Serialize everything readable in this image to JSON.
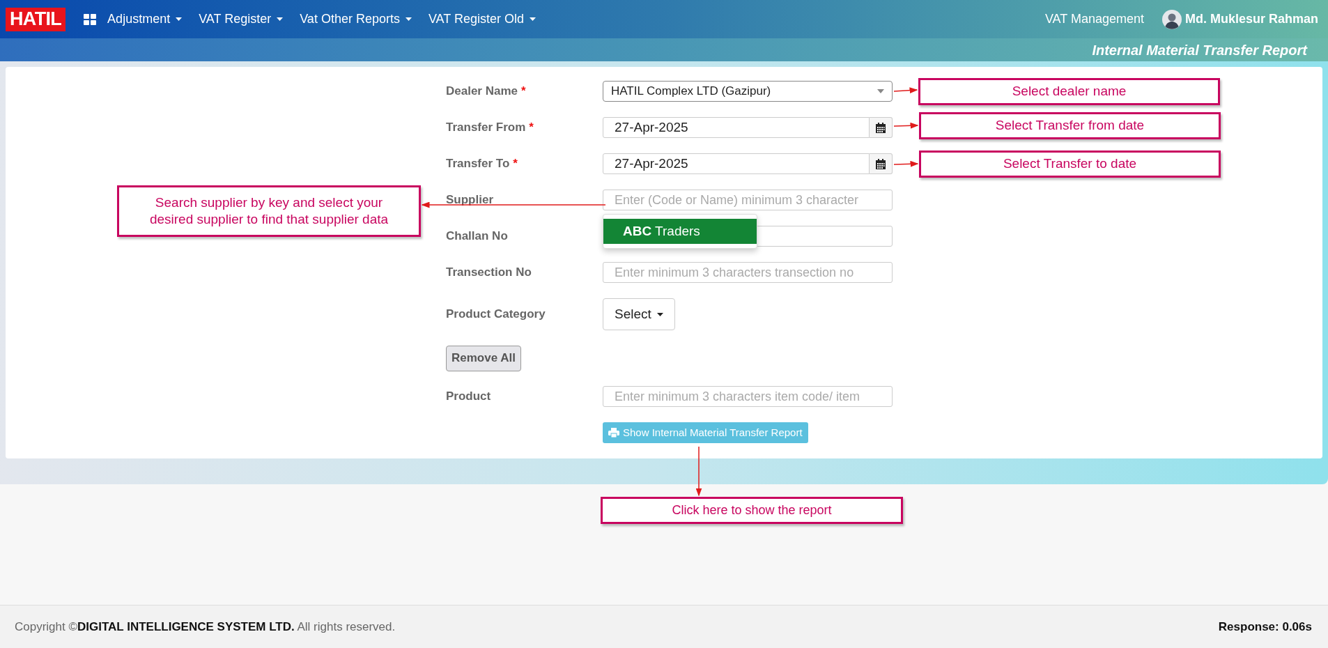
{
  "nav": {
    "brand": "HATIL",
    "menus": [
      {
        "label": "Adjustment"
      },
      {
        "label": "VAT Register"
      },
      {
        "label": "Vat Other Reports"
      },
      {
        "label": "VAT Register Old"
      }
    ],
    "module": "VAT Management",
    "user": "Md. Muklesur Rahman"
  },
  "page_title": "Internal Material Transfer Report",
  "fields": [
    {
      "kind": "select",
      "label": "Dealer Name",
      "required_mark": "*",
      "value": "HATIL Complex LTD (Gazipur)"
    },
    {
      "kind": "date",
      "label": "Transfer From",
      "required_mark": "*",
      "value": "27-Apr-2025"
    },
    {
      "kind": "date",
      "label": "Transfer To",
      "required_mark": "*",
      "value": "27-Apr-2025"
    },
    {
      "kind": "text",
      "label": "Supplier",
      "placeholder": "Enter (Code or Name) minimum 3 character"
    },
    {
      "kind": "text",
      "label": "Challan No"
    },
    {
      "kind": "text",
      "label": "Transection No",
      "placeholder": "Enter minimum 3 characters transection no"
    },
    {
      "kind": "dropdown",
      "label": "Product Category",
      "button": "Select"
    },
    {
      "kind": "remove",
      "button": "Remove All"
    },
    {
      "kind": "text",
      "label": "Product",
      "placeholder": "Enter minimum 3 characters item code/ item"
    }
  ],
  "suggestions": [
    {
      "text": "**ABC** Traders",
      "selected": true
    }
  ],
  "submit": "Show Internal Material Transfer Report",
  "annotations": [
    {
      "text": "Select dealer name"
    },
    {
      "text": "Select Transfer from date"
    },
    {
      "text": "Select Transfer to date"
    },
    {
      "text": "Search supplier by key and select your desired supplier to  find that supplier data"
    },
    {
      "text": "Click here to show the report"
    }
  ],
  "footer": {
    "copyright": "Copyright ©**DIGITAL INTELLIGENCE SYSTEM LTD.** All rights reserved.",
    "response": "Response: 0.06s"
  }
}
